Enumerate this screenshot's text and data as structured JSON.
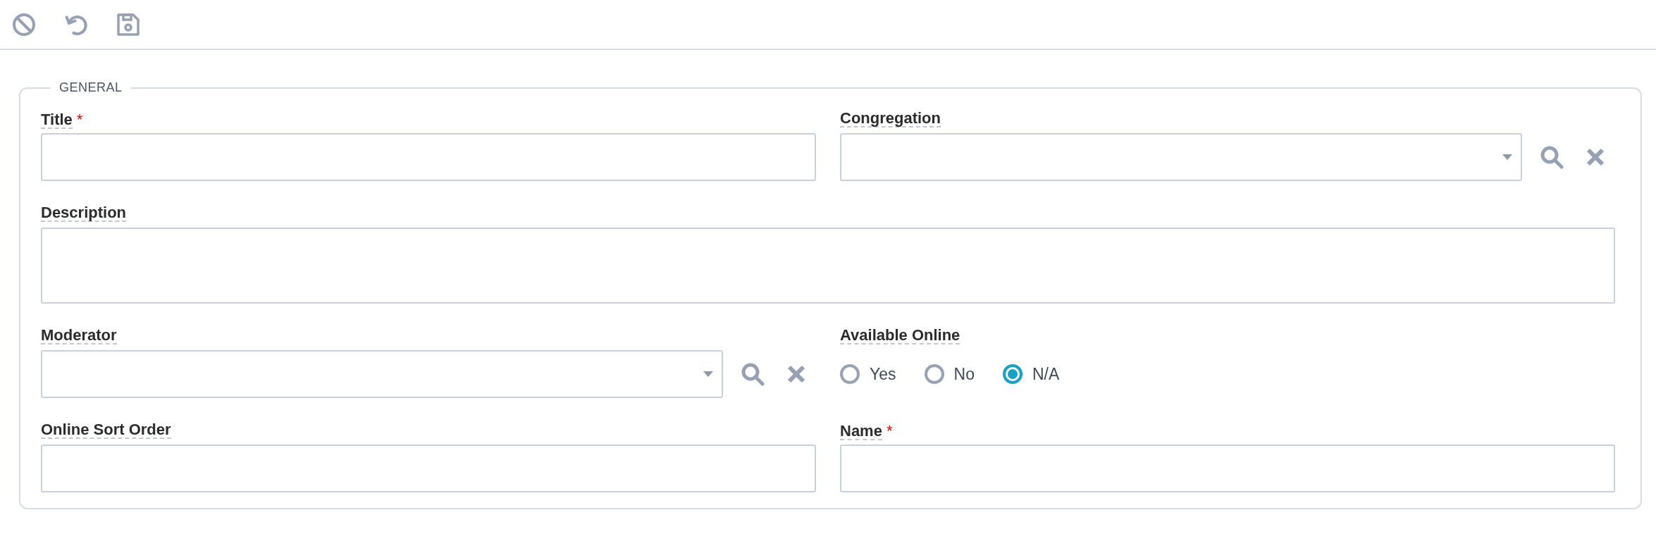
{
  "toolbar": [
    {
      "kind": "cancel"
    },
    {
      "kind": "undo"
    },
    {
      "kind": "save"
    }
  ],
  "section": {
    "legend": "GENERAL",
    "required_marker": "*",
    "fields": [
      {
        "kind": "text",
        "label": "Title",
        "required": true,
        "wide": false
      },
      {
        "kind": "combo",
        "label": "Congregation",
        "required": false,
        "wide": false
      },
      {
        "kind": "textarea",
        "label": "Description",
        "required": false,
        "wide": true
      },
      {
        "kind": "combo",
        "label": "Moderator",
        "required": false,
        "wide": false
      },
      {
        "kind": "radio",
        "label": "Available Online",
        "required": false,
        "wide": false,
        "options": [
          {
            "label": "Yes",
            "selected": false
          },
          {
            "label": "No",
            "selected": false
          },
          {
            "label": "N/A",
            "selected": true
          }
        ]
      },
      {
        "kind": "text",
        "label": "Online Sort Order",
        "required": false,
        "wide": false
      },
      {
        "kind": "text",
        "label": "Name",
        "required": true,
        "wide": false
      }
    ]
  }
}
